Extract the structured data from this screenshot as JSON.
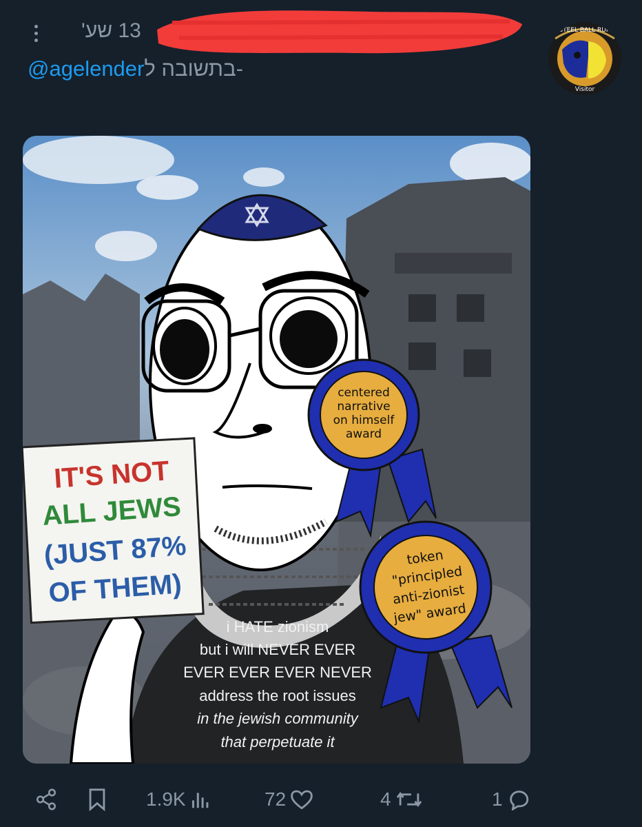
{
  "header": {
    "time": "13 שע'",
    "reply_prefix": "בתשובה ל-",
    "reply_handle": "@agelender"
  },
  "media": {
    "sign_lines": [
      "IT'S NOT",
      "ALL JEWS",
      "(JUST 87%",
      "OF THEM)"
    ],
    "ribbon_1_lines": [
      "centered",
      "narrative",
      "on himself",
      "award"
    ],
    "ribbon_2_lines": [
      "token",
      "\"principled",
      "anti-zionist",
      "jew\" award"
    ],
    "shirt_lines": [
      "i HATE zionism",
      "but i will NEVER EVER",
      "EVER EVER EVER NEVER",
      "address the root issues",
      "in the jewish community",
      "that perpetuate it"
    ],
    "avatar_text_top": "STEEL BALL RUN",
    "avatar_text_bottom": "Visitor"
  },
  "actions": {
    "views": "1.9K",
    "likes": "72",
    "reposts": "4",
    "replies": "1"
  },
  "colors": {
    "background": "#15202b",
    "muted": "#8b98a5",
    "link": "#1d9bf0",
    "redaction": "#f23c3a"
  }
}
